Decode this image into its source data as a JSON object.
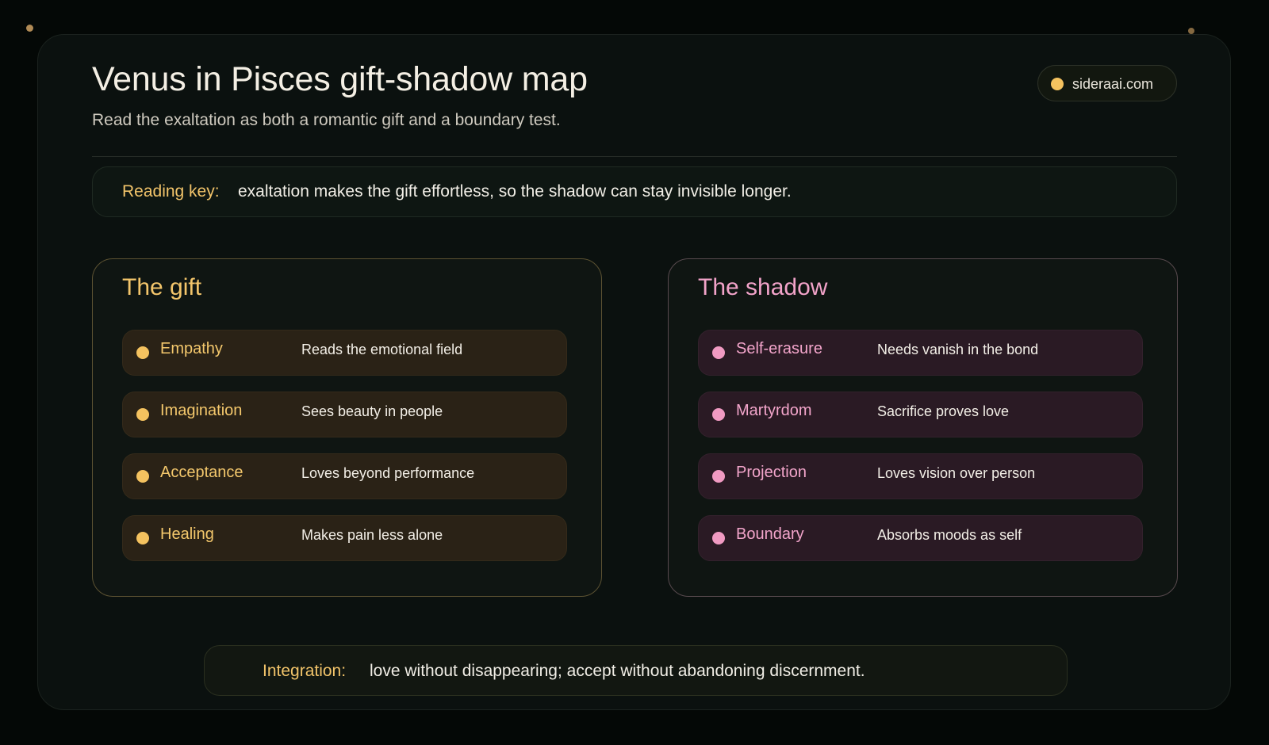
{
  "header": {
    "title": "Venus in Pisces gift-shadow map",
    "subtitle": "Read the exaltation as both a romantic gift and a boundary test.",
    "brand": "sideraai.com"
  },
  "reading_key": {
    "label": "Reading key:",
    "text": "exaltation makes the gift effortless, so the shadow can stay invisible longer."
  },
  "gift": {
    "title": "The gift",
    "items": [
      {
        "name": "Empathy",
        "desc": "Reads the emotional field"
      },
      {
        "name": "Imagination",
        "desc": "Sees beauty in people"
      },
      {
        "name": "Acceptance",
        "desc": "Loves beyond performance"
      },
      {
        "name": "Healing",
        "desc": "Makes pain less alone"
      }
    ]
  },
  "shadow": {
    "title": "The shadow",
    "items": [
      {
        "name": "Self-erasure",
        "desc": "Needs vanish in the bond"
      },
      {
        "name": "Martyrdom",
        "desc": "Sacrifice proves love"
      },
      {
        "name": "Projection",
        "desc": "Loves vision over person"
      },
      {
        "name": "Boundary",
        "desc": "Absorbs moods as self"
      }
    ]
  },
  "integration": {
    "label": "Integration:",
    "text": "love without disappearing; accept without abandoning discernment."
  },
  "colors": {
    "gift_accent": "#f4c25f",
    "shadow_accent": "#f09ac2",
    "background": "#0b110f"
  }
}
